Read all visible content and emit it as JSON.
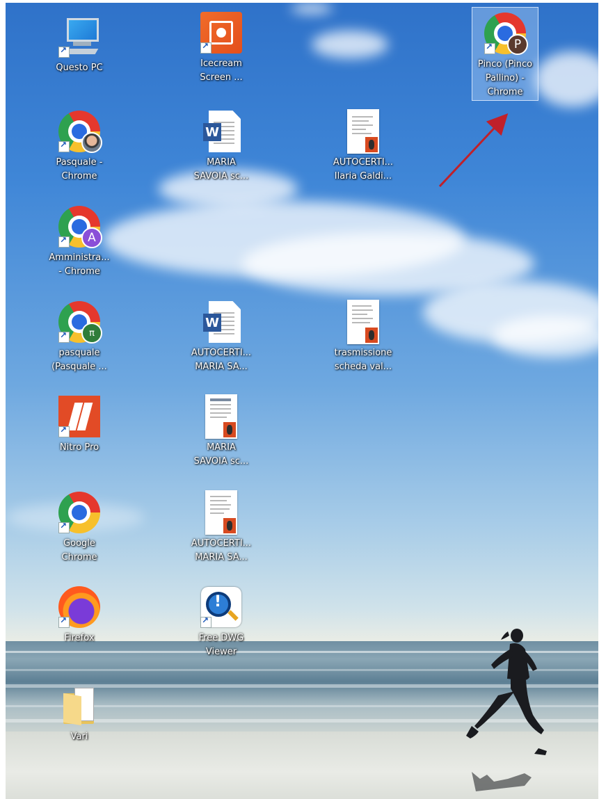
{
  "desktop": {
    "icons": [
      {
        "id": "questo-pc",
        "label": "Questo PC",
        "type": "computer",
        "shortcut": true
      },
      {
        "id": "icecream",
        "label": "Icecream Screen ...",
        "type": "icecream",
        "shortcut": true
      },
      {
        "id": "pinco",
        "label": "Pinco (Pinco Pallino) - Chrome",
        "type": "chrome",
        "badge": "P",
        "badge_color": "#5a3a2e",
        "shortcut": true,
        "selected": true
      },
      {
        "id": "pasquale-chrome",
        "label": "Pasquale - Chrome",
        "type": "chrome",
        "badge": "photo",
        "badge_color": "#d7dce2",
        "shortcut": true
      },
      {
        "id": "maria-savoia-1",
        "label": "MARIA SAVOIA sc...",
        "type": "word"
      },
      {
        "id": "autocerti-ilaria",
        "label": "AUTOCERTI... Ilaria Galdi...",
        "type": "pdf"
      },
      {
        "id": "amministra",
        "label": "Amministra... - Chrome",
        "type": "chrome",
        "badge": "A",
        "badge_color": "#8a4fd8",
        "shortcut": true
      },
      {
        "id": "pasquale-2",
        "label": "pasquale (Pasquale ...",
        "type": "chrome",
        "badge": "leaf",
        "badge_color": "#2f7d3a",
        "shortcut": true
      },
      {
        "id": "autocerti-maria-1",
        "label": "AUTOCERTI... MARIA SA...",
        "type": "word"
      },
      {
        "id": "trasmissione",
        "label": "trasmissione scheda val...",
        "type": "pdf"
      },
      {
        "id": "nitro",
        "label": "Nitro Pro",
        "type": "nitro",
        "shortcut": true
      },
      {
        "id": "maria-savoia-2",
        "label": "MARIA SAVOIA sc...",
        "type": "pdf"
      },
      {
        "id": "google-chrome",
        "label": "Google Chrome",
        "type": "chrome",
        "shortcut": true
      },
      {
        "id": "autocerti-maria-2",
        "label": "AUTOCERTI... MARIA SA...",
        "type": "pdf"
      },
      {
        "id": "firefox",
        "label": "Firefox",
        "type": "firefox",
        "shortcut": true
      },
      {
        "id": "free-dwg",
        "label": "Free DWG Viewer",
        "type": "dwg",
        "shortcut": true
      },
      {
        "id": "vari",
        "label": "Vari",
        "type": "folder"
      }
    ]
  },
  "annotation": {
    "color": "#c0202a"
  }
}
